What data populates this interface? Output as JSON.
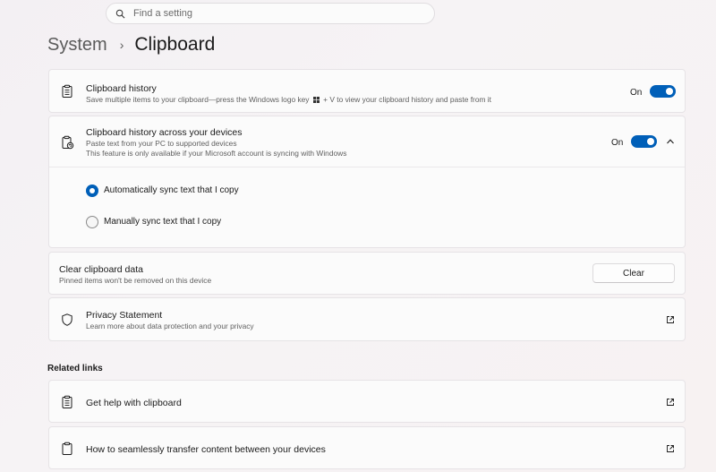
{
  "search": {
    "placeholder": "Find a setting"
  },
  "breadcrumb": {
    "parent": "System",
    "separator": "›",
    "current": "Clipboard"
  },
  "clipboard_history": {
    "title": "Clipboard history",
    "desc_part1": "Save multiple items to your clipboard—press the Windows logo key",
    "desc_part2": "+ V to view your clipboard history and paste from it",
    "state": "On",
    "enabled": true
  },
  "sync": {
    "title": "Clipboard history across your devices",
    "desc1": "Paste text from your PC to supported devices",
    "desc2": "This feature is only available if your Microsoft account is syncing with Windows",
    "state": "On",
    "enabled": true,
    "expanded": true,
    "options": [
      {
        "label": "Automatically sync text that I copy",
        "selected": true
      },
      {
        "label": "Manually sync text that I copy",
        "selected": false
      }
    ]
  },
  "clear_data": {
    "title": "Clear clipboard data",
    "desc": "Pinned items won't be removed on this device",
    "button": "Clear"
  },
  "privacy": {
    "title": "Privacy Statement",
    "desc": "Learn more about data protection and your privacy"
  },
  "related": {
    "heading": "Related links",
    "links": [
      {
        "label": "Get help with clipboard"
      },
      {
        "label": "How to seamlessly transfer content between your devices"
      }
    ]
  },
  "colors": {
    "accent": "#005fb8"
  },
  "icons": [
    "search-icon",
    "clipboard-list-icon",
    "clipboard-sync-icon",
    "shield-icon",
    "external-link-icon",
    "chevron-up-icon",
    "windows-logo-icon",
    "clipboard-icon"
  ]
}
